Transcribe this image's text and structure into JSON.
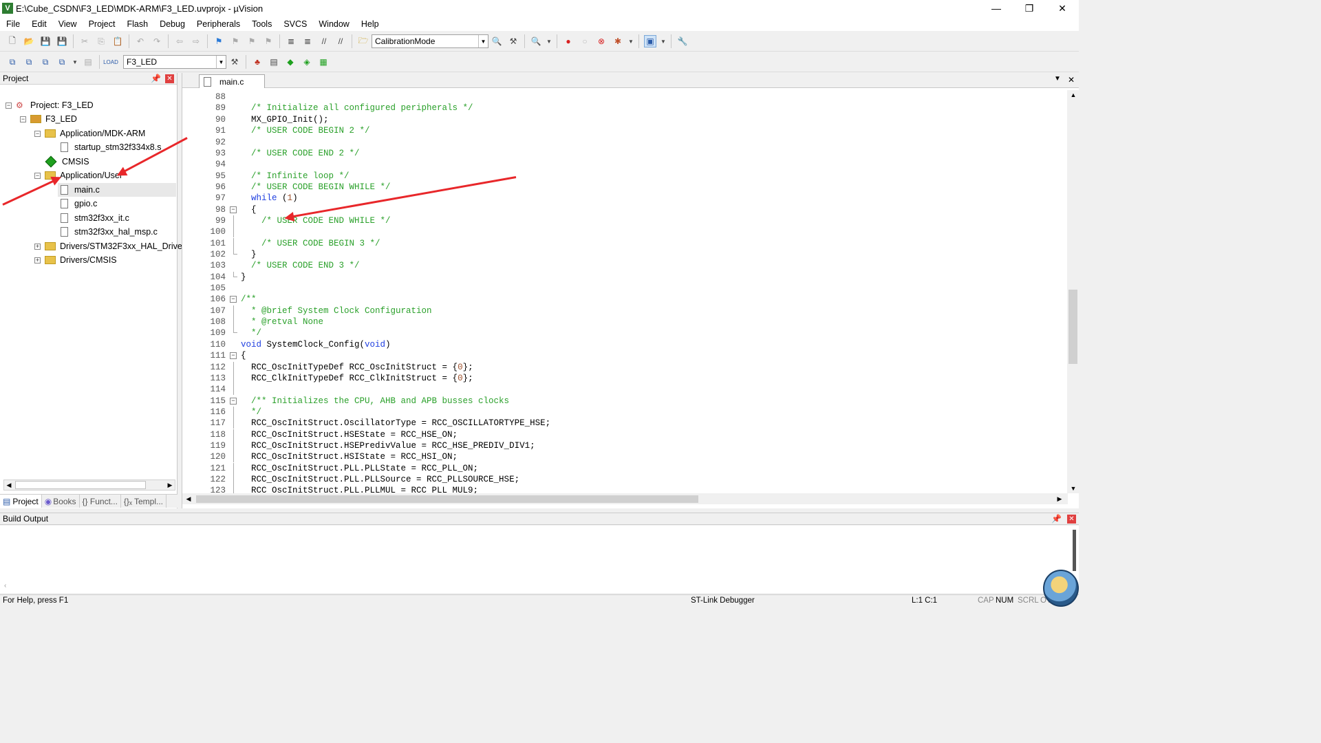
{
  "window": {
    "title": "E:\\Cube_CSDN\\F3_LED\\MDK-ARM\\F3_LED.uvprojx - µVision",
    "minimize": "—",
    "restore": "❐",
    "close": "✕"
  },
  "menu": [
    "File",
    "Edit",
    "View",
    "Project",
    "Flash",
    "Debug",
    "Peripherals",
    "Tools",
    "SVCS",
    "Window",
    "Help"
  ],
  "toolbar1": {
    "mode_combo": "CalibrationMode"
  },
  "toolbar2": {
    "target_combo": "F3_LED"
  },
  "project_panel": {
    "title": "Project",
    "tree": [
      {
        "label": "Project: F3_LED",
        "level": 0,
        "type": "project",
        "expander": "−"
      },
      {
        "label": "F3_LED",
        "level": 1,
        "type": "target",
        "expander": "−"
      },
      {
        "label": "Application/MDK-ARM",
        "level": 2,
        "type": "folder",
        "expander": "−"
      },
      {
        "label": "startup_stm32f334x8.s",
        "level": 3,
        "type": "file"
      },
      {
        "label": "CMSIS",
        "level": 2,
        "type": "component"
      },
      {
        "label": "Application/User",
        "level": 2,
        "type": "folder",
        "expander": "−"
      },
      {
        "label": "main.c",
        "level": 3,
        "type": "file",
        "selected": true
      },
      {
        "label": "gpio.c",
        "level": 3,
        "type": "file"
      },
      {
        "label": "stm32f3xx_it.c",
        "level": 3,
        "type": "file"
      },
      {
        "label": "stm32f3xx_hal_msp.c",
        "level": 3,
        "type": "file"
      },
      {
        "label": "Drivers/STM32F3xx_HAL_Driver",
        "level": 2,
        "type": "folder",
        "expander": "+"
      },
      {
        "label": "Drivers/CMSIS",
        "level": 2,
        "type": "folder",
        "expander": "+"
      }
    ],
    "tabs": [
      "Project",
      "Books",
      "{} Funct...",
      "{}ₓ Templ..."
    ]
  },
  "editor": {
    "tab_label": "main.c",
    "lines": [
      {
        "n": "88",
        "text": ""
      },
      {
        "n": "89",
        "text": "  /* Initialize all configured peripherals */",
        "cls": "cm"
      },
      {
        "n": "90",
        "text": "  MX_GPIO_Init();"
      },
      {
        "n": "91",
        "text": "  /* USER CODE BEGIN 2 */",
        "cls": "cm"
      },
      {
        "n": "92",
        "text": ""
      },
      {
        "n": "93",
        "text": "  /* USER CODE END 2 */",
        "cls": "cm"
      },
      {
        "n": "94",
        "text": ""
      },
      {
        "n": "95",
        "text": "  /* Infinite loop */",
        "cls": "cm"
      },
      {
        "n": "96",
        "text": "  /* USER CODE BEGIN WHILE */",
        "cls": "cm"
      },
      {
        "n": "97",
        "text": "  while (1)",
        "cls": "kwline"
      },
      {
        "n": "98",
        "text": "  {",
        "fold": "box"
      },
      {
        "n": "99",
        "text": "    /* USER CODE END WHILE */",
        "cls": "cm",
        "fold": "line"
      },
      {
        "n": "100",
        "text": "",
        "fold": "line"
      },
      {
        "n": "101",
        "text": "    /* USER CODE BEGIN 3 */",
        "cls": "cm",
        "fold": "line"
      },
      {
        "n": "102",
        "text": "  }",
        "fold": "end"
      },
      {
        "n": "103",
        "text": "  /* USER CODE END 3 */",
        "cls": "cm"
      },
      {
        "n": "104",
        "text": "}",
        "fold": "end"
      },
      {
        "n": "105",
        "text": ""
      },
      {
        "n": "106",
        "text": "/**",
        "cls": "cm",
        "fold": "box"
      },
      {
        "n": "107",
        "text": "  * @brief System Clock Configuration",
        "cls": "cm",
        "fold": "line"
      },
      {
        "n": "108",
        "text": "  * @retval None",
        "cls": "cm",
        "fold": "line"
      },
      {
        "n": "109",
        "text": "  */",
        "cls": "cm",
        "fold": "end"
      },
      {
        "n": "110",
        "text": "void SystemClock_Config(void)",
        "cls": "voidline"
      },
      {
        "n": "111",
        "text": "{",
        "fold": "box"
      },
      {
        "n": "112",
        "text": "  RCC_OscInitTypeDef RCC_OscInitStruct = {0};",
        "fold": "line"
      },
      {
        "n": "113",
        "text": "  RCC_ClkInitTypeDef RCC_ClkInitStruct = {0};",
        "fold": "line"
      },
      {
        "n": "114",
        "text": "",
        "fold": "line"
      },
      {
        "n": "115",
        "text": "  /** Initializes the CPU, AHB and APB busses clocks",
        "cls": "cm",
        "fold": "box"
      },
      {
        "n": "116",
        "text": "  */",
        "cls": "cm",
        "fold": "line"
      },
      {
        "n": "117",
        "text": "  RCC_OscInitStruct.OscillatorType = RCC_OSCILLATORTYPE_HSE;",
        "fold": "line"
      },
      {
        "n": "118",
        "text": "  RCC_OscInitStruct.HSEState = RCC_HSE_ON;",
        "fold": "line"
      },
      {
        "n": "119",
        "text": "  RCC_OscInitStruct.HSEPredivValue = RCC_HSE_PREDIV_DIV1;",
        "fold": "line"
      },
      {
        "n": "120",
        "text": "  RCC_OscInitStruct.HSIState = RCC_HSI_ON;",
        "fold": "line"
      },
      {
        "n": "121",
        "text": "  RCC_OscInitStruct.PLL.PLLState = RCC_PLL_ON;",
        "fold": "line"
      },
      {
        "n": "122",
        "text": "  RCC_OscInitStruct.PLL.PLLSource = RCC_PLLSOURCE_HSE;",
        "fold": "line"
      },
      {
        "n": "123",
        "text": "  RCC_OscInitStruct.PLL.PLLMUL = RCC_PLL_MUL9;",
        "fold": "line"
      }
    ]
  },
  "build_output": {
    "title": "Build Output"
  },
  "status": {
    "help": "For Help, press F1",
    "debugger": "ST-Link Debugger",
    "position": "L:1 C:1",
    "cap": "CAP",
    "num": "NUM",
    "scrl": "SCRL",
    "ovr": "OVR"
  },
  "colors": {
    "comment": "#2aa02a",
    "keyword": "#2040e0",
    "annotation_arrow": "#e8272a"
  },
  "icons": [
    "new-file-icon",
    "open-icon",
    "save-icon",
    "save-all-icon",
    "cut-icon",
    "copy-icon",
    "paste-icon",
    "undo-icon",
    "redo-icon",
    "nav-back-icon",
    "nav-forward-icon",
    "bookmark-icon",
    "indent-icon",
    "comment-icon",
    "find-icon",
    "debug-start-icon",
    "breakpoint-icon",
    "settings-icon",
    "build-icon",
    "rebuild-icon",
    "load-icon",
    "magic-wand-icon",
    "pack-installer-icon"
  ]
}
